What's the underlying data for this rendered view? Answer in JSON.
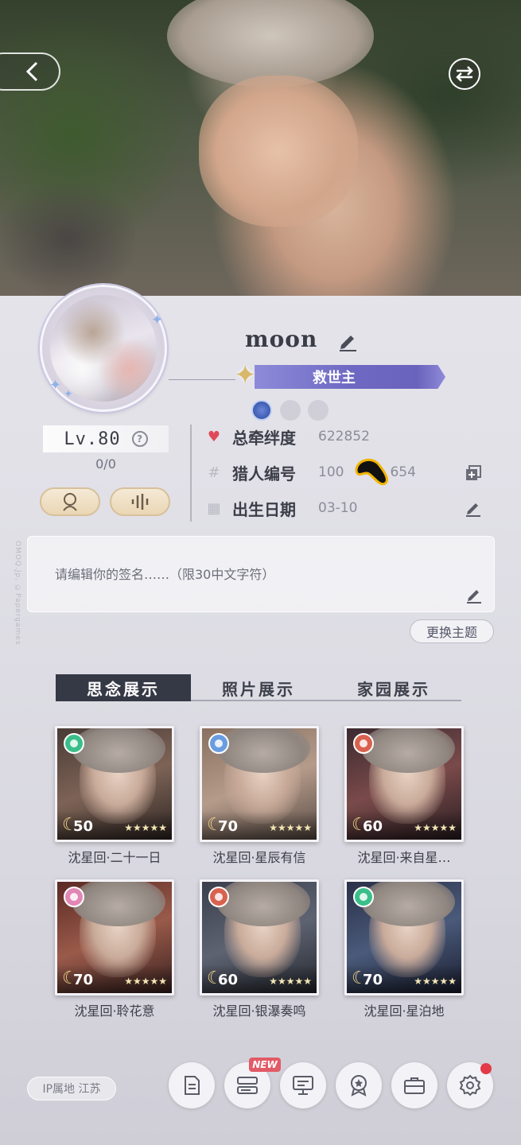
{
  "profile": {
    "username": "moon",
    "title": "救世主",
    "level": "Lv.80",
    "level_progress": "0/0",
    "stats": [
      {
        "label": "总牵绊度",
        "value": "622852"
      },
      {
        "label": "猎人编号",
        "value": "100"
      },
      {
        "label": "出生日期",
        "value": "03-10"
      }
    ],
    "hunter_id_tail": "654",
    "signature_placeholder": "请编辑你的签名……（限30中文字符）",
    "change_theme": "更换主题",
    "watermark": "OMOQ.Jp, ©Papergames"
  },
  "tabs": [
    "思念展示",
    "照片展示",
    "家园展示"
  ],
  "cards": [
    {
      "name": "沈星回·二十一日",
      "level": "50",
      "gem_color": "#3bbf8a"
    },
    {
      "name": "沈星回·星辰有信",
      "level": "70",
      "gem_color": "#6a9de0"
    },
    {
      "name": "沈星回·来自星…",
      "level": "60",
      "gem_color": "#d9624f"
    },
    {
      "name": "沈星回·聆花意",
      "level": "70",
      "gem_color": "#e087b5"
    },
    {
      "name": "沈星回·银瀑奏鸣",
      "level": "60",
      "gem_color": "#d9624f"
    },
    {
      "name": "沈星回·星泊地",
      "level": "70",
      "gem_color": "#3bbf8a"
    }
  ],
  "card_stars": "★★★★★",
  "bottom": {
    "ip_location": "IP属地  江苏",
    "new_badge": "NEW"
  }
}
